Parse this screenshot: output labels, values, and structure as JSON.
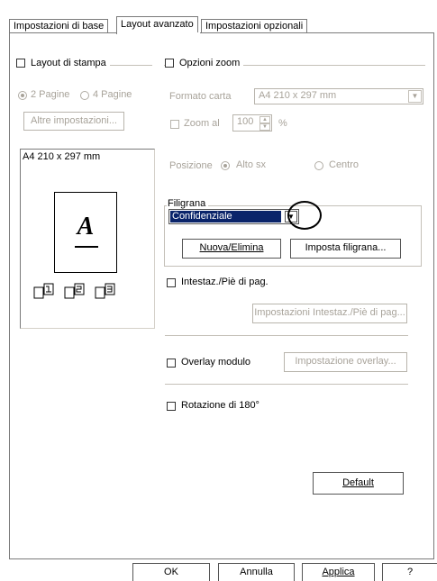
{
  "tabs": [
    {
      "label": "Impostazioni di base"
    },
    {
      "label": "Layout avanzato"
    },
    {
      "label": "Impostazioni opzionali"
    }
  ],
  "layout": {
    "checkbox_label": "Layout di stampa",
    "radio_2": "2 Pagine",
    "radio_4": "4 Pagine",
    "more_button": "Altre impostazioni..."
  },
  "preview": {
    "paper_label": "A4 210 x 297 mm",
    "letter": "A"
  },
  "zoom": {
    "checkbox_label": "Opzioni zoom",
    "paper_format_label": "Formato carta",
    "paper_format_value": "A4 210 x 297 mm",
    "zoom_label": "Zoom al",
    "zoom_value": "100",
    "percent": "%",
    "position_label": "Posizione",
    "position_top_left": "Alto sx",
    "position_center": "Centro"
  },
  "watermark": {
    "group_label": "Filigrana",
    "selected": "Confidenziale",
    "new_delete_button": "Nuova/Elimina",
    "set_button": "Imposta filigrana..."
  },
  "header_footer": {
    "checkbox_label": "Intestaz./Piè di pag.",
    "settings_button": "Impostazioni Intestaz./Piè di pag..."
  },
  "overlay": {
    "checkbox_label": "Overlay modulo",
    "settings_button": "Impostazione overlay..."
  },
  "rotation": {
    "checkbox_label": "Rotazione di 180°"
  },
  "default_button": "Default",
  "footer": {
    "ok": "OK",
    "cancel": "Annulla",
    "apply": "Applica",
    "help": "?"
  }
}
